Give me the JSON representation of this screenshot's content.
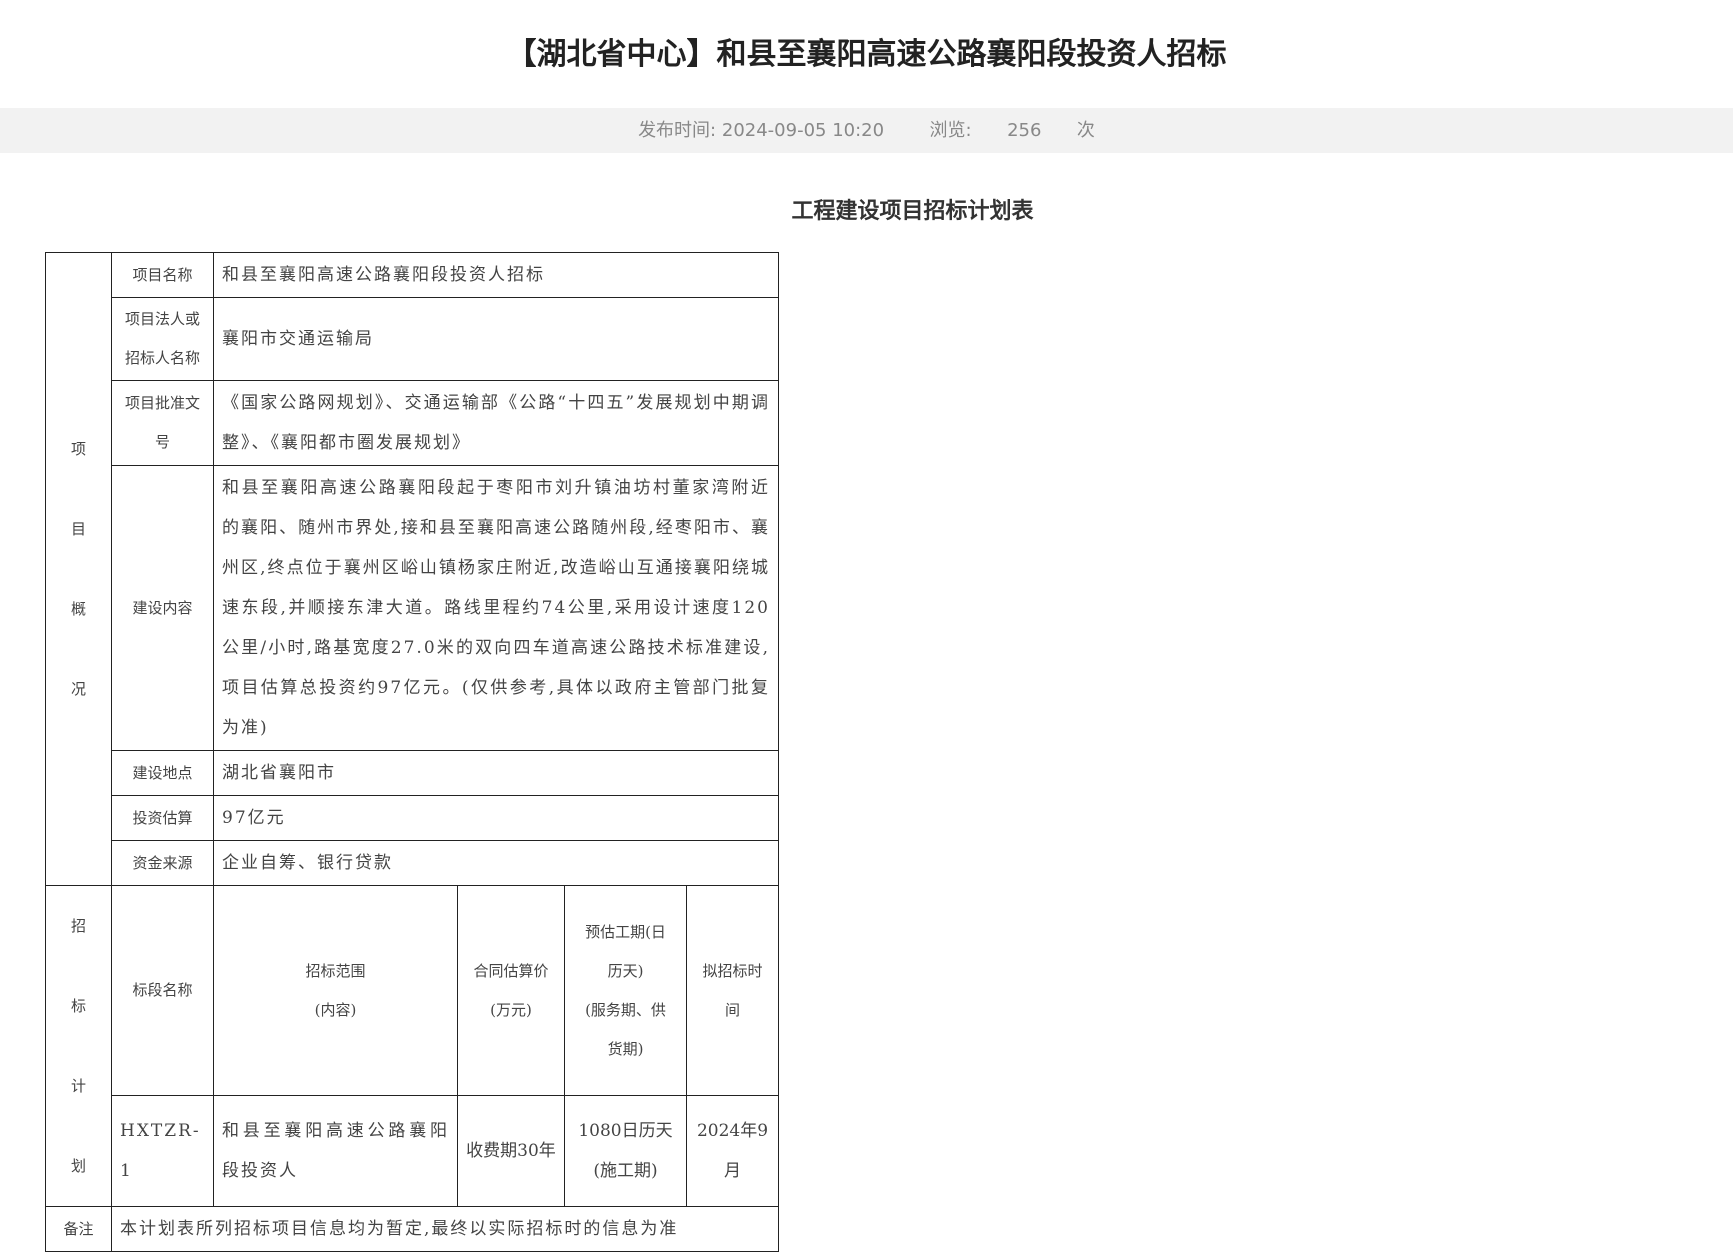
{
  "page": {
    "title": "【湖北省中心】和县至襄阳高速公路襄阳段投资人招标",
    "publish_label": "发布时间:",
    "publish_time": "2024-09-05 10:20",
    "views_label": "浏览:",
    "views_count": "256",
    "views_unit": "次"
  },
  "document": {
    "heading": "工程建设项目招标计划表"
  },
  "overview": {
    "group_chars": [
      "项",
      "目",
      "概",
      "况"
    ],
    "rows": [
      {
        "label_lines": [
          "项目名称"
        ],
        "value": "和县至襄阳高速公路襄阳段投资人招标"
      },
      {
        "label_lines": [
          "项目法人或",
          "招标人名称"
        ],
        "value": "襄阳市交通运输局"
      },
      {
        "label_lines": [
          "项目批准文",
          "号"
        ],
        "value": "《国家公路网规划》、交通运输部《公路“十四五”发展规划中期调整》、《襄阳都市圈发展规划》"
      },
      {
        "label_lines": [
          "建设内容"
        ],
        "value": "和县至襄阳高速公路襄阳段起于枣阳市刘升镇油坊村董家湾附近的襄阳、随州市界处,接和县至襄阳高速公路随州段,经枣阳市、襄州区,终点位于襄州区峪山镇杨家庄附近,改造峪山互通接襄阳绕城速东段,并顺接东津大道。路线里程约74公里,采用设计速度120公里/小时,路基宽度27.0米的双向四车道高速公路技术标准建设,项目估算总投资约97亿元。(仅供参考,具体以政府主管部门批复为准)"
      },
      {
        "label_lines": [
          "建设地点"
        ],
        "value": "湖北省襄阳市"
      },
      {
        "label_lines": [
          "投资估算"
        ],
        "value": "97亿元"
      },
      {
        "label_lines": [
          "资金来源"
        ],
        "value": "企业自筹、银行贷款"
      }
    ]
  },
  "plan": {
    "group_chars": [
      "招",
      "标",
      "计",
      "划"
    ],
    "headers": {
      "section_name": [
        "标段名称"
      ],
      "scope": [
        "招标范围",
        "(内容)"
      ],
      "price": [
        "合同估算价",
        "(万元)"
      ],
      "duration": [
        "预估工期(日",
        "历天)",
        "(服务期、供",
        "货期)"
      ],
      "time": [
        "拟招标时",
        "间"
      ]
    },
    "row": {
      "section_name": "HXTZR-1",
      "scope": "和县至襄阳高速公路襄阳段投资人",
      "price": "收费期30年",
      "duration_lines": [
        "1080日历天",
        "(施工期)"
      ],
      "time": "2024年9月"
    }
  },
  "remarks": {
    "label": "备注",
    "text": "本计划表所列招标项目信息均为暂定,最终以实际招标时的信息为准"
  }
}
